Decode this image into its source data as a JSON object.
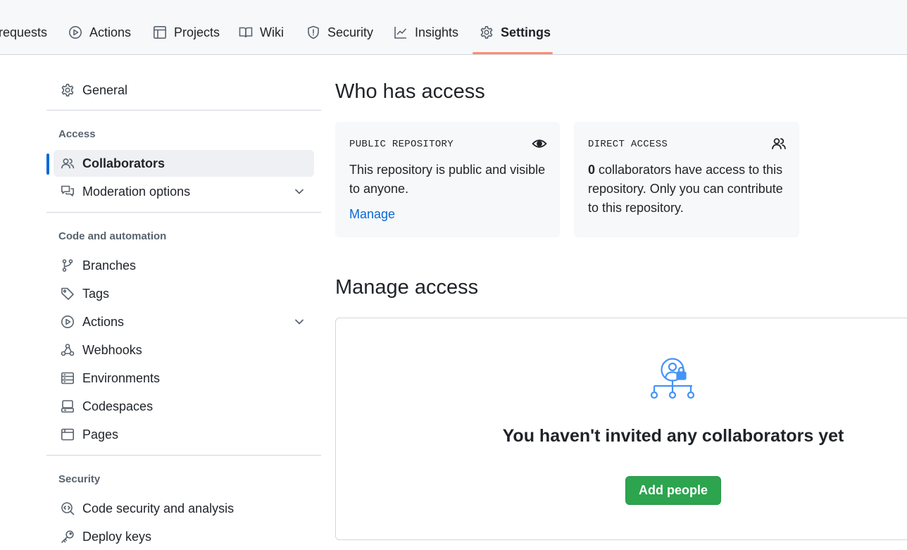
{
  "topnav": {
    "tabs": [
      {
        "label": "requests",
        "icon": "pull-request-icon"
      },
      {
        "label": "Actions",
        "icon": "play-icon"
      },
      {
        "label": "Projects",
        "icon": "table-icon"
      },
      {
        "label": "Wiki",
        "icon": "book-icon"
      },
      {
        "label": "Security",
        "icon": "shield-icon"
      },
      {
        "label": "Insights",
        "icon": "graph-icon"
      },
      {
        "label": "Settings",
        "icon": "gear-icon",
        "selected": true
      }
    ],
    "accent_color": "#fd8c73"
  },
  "sidebar": {
    "general": "General",
    "access_heading": "Access",
    "collaborators": "Collaborators",
    "moderation": "Moderation options",
    "code_heading": "Code and automation",
    "branches": "Branches",
    "tags": "Tags",
    "actions": "Actions",
    "webhooks": "Webhooks",
    "environments": "Environments",
    "codespaces": "Codespaces",
    "pages": "Pages",
    "security_heading": "Security",
    "code_security": "Code security and analysis",
    "deploy_keys": "Deploy keys",
    "active_color": "#0969da"
  },
  "main": {
    "who_title": "Who has access",
    "public_box": {
      "label": "PUBLIC REPOSITORY",
      "text": "This repository is public and visible to anyone.",
      "link": "Manage"
    },
    "direct_box": {
      "label": "DIRECT ACCESS",
      "count": "0",
      "text": " collaborators have access to this repository. Only you can contribute to this repository."
    },
    "manage_title": "Manage access",
    "empty_title": "You haven't invited any collaborators yet",
    "add_button": "Add people",
    "button_color": "#2da44e"
  }
}
